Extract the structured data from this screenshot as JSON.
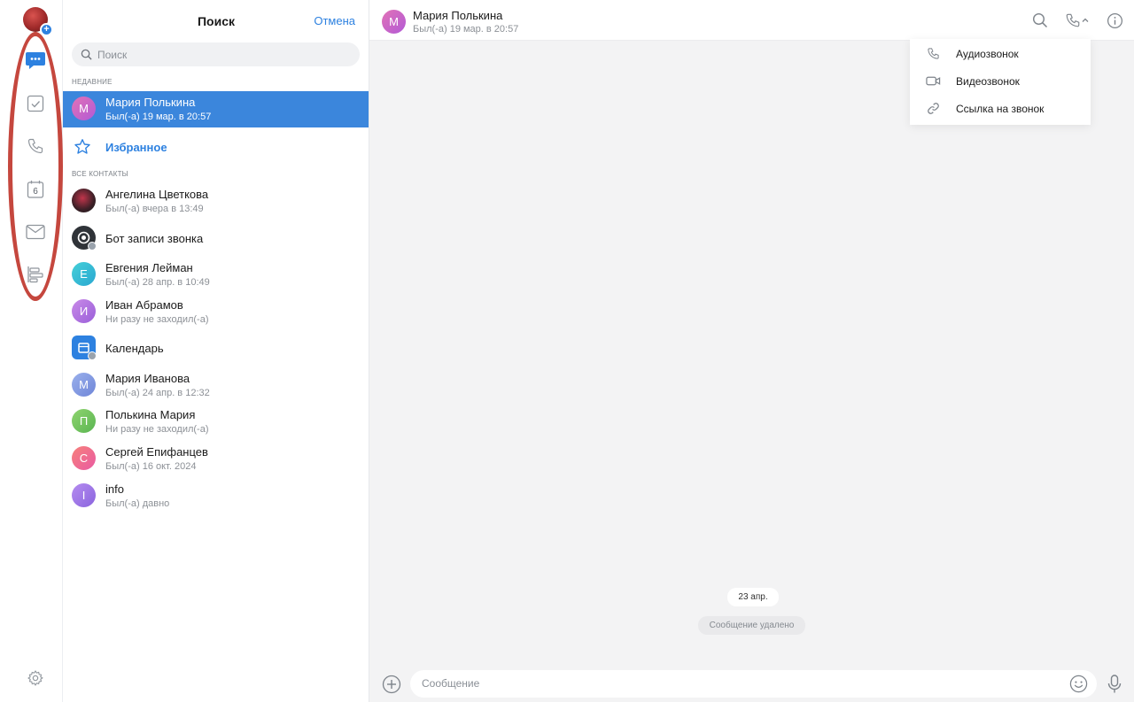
{
  "rail": {
    "items": [
      {
        "name": "messages",
        "icon": "chat-bubble-icon",
        "active": true
      },
      {
        "name": "tasks",
        "icon": "checkbox-icon"
      },
      {
        "name": "calls",
        "icon": "phone-icon"
      },
      {
        "name": "calendar",
        "icon": "calendar-icon",
        "badge": "6"
      },
      {
        "name": "mail",
        "icon": "envelope-icon"
      },
      {
        "name": "boards",
        "icon": "board-icon"
      }
    ],
    "settings_icon": "gear-icon",
    "accent_color": "#2d81e0",
    "highlight_color": "#c5473e"
  },
  "list": {
    "title": "Поиск",
    "cancel_label": "Отмена",
    "search_placeholder": "Поиск",
    "recent_label": "НЕДАВНИЕ",
    "all_contacts_label": "ВСЕ КОНТАКТЫ",
    "recent": {
      "initial": "М",
      "name": "Мария Полькина",
      "status": "Был(-а) 19 мар. в 20:57"
    },
    "favorites_label": "Избранное",
    "contacts": [
      {
        "initial": "",
        "name": "Ангелина Цветкова",
        "status": "Был(-а) вчера в 13:49"
      },
      {
        "initial": "",
        "name": "Бот записи звонка",
        "status": ""
      },
      {
        "initial": "Е",
        "name": "Евгения Лейман",
        "status": "Был(-а) 28 апр. в 10:49"
      },
      {
        "initial": "И",
        "name": "Иван Абрамов",
        "status": "Ни разу не заходил(-а)"
      },
      {
        "initial": "",
        "name": "Календарь",
        "status": ""
      },
      {
        "initial": "М",
        "name": "Мария Иванова",
        "status": "Был(-а) 24 апр. в 12:32"
      },
      {
        "initial": "П",
        "name": "Полькина Мария",
        "status": "Ни разу не заходил(-а)"
      },
      {
        "initial": "С",
        "name": "Сергей Епифанцев",
        "status": "Был(-а) 16 окт. 2024"
      },
      {
        "initial": "I",
        "name": "info",
        "status": "Был(-а) давно"
      }
    ]
  },
  "chat": {
    "avatar_initial": "М",
    "name": "Мария Полькина",
    "status": "Был(-а) 19 мар. в 20:57",
    "header_icons": [
      "search-icon",
      "phone-icon",
      "chevron-up-icon",
      "info-icon"
    ],
    "call_menu": [
      {
        "icon": "phone-icon",
        "label": "Аудиозвонок"
      },
      {
        "icon": "video-camera-icon",
        "label": "Видеозвонок"
      },
      {
        "icon": "link-icon",
        "label": "Ссылка на звонок"
      }
    ],
    "date_separator": "23 апр.",
    "deleted_message": "Сообщение удалено",
    "composer_placeholder": "Сообщение"
  }
}
